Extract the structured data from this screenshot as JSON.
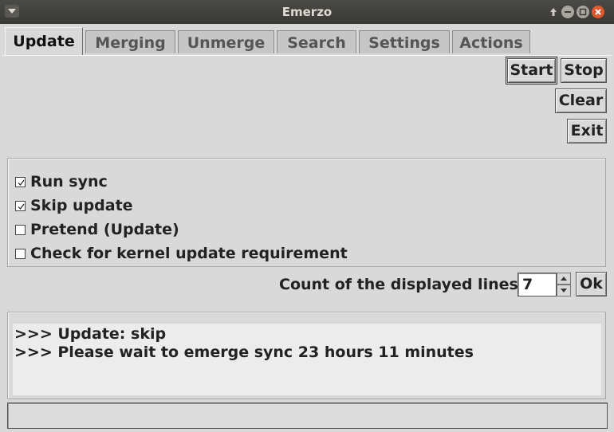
{
  "window": {
    "title": "Emerzo"
  },
  "tabs": [
    {
      "label": "Update",
      "active": true
    },
    {
      "label": "Merging",
      "active": false
    },
    {
      "label": "Unmerge",
      "active": false
    },
    {
      "label": "Search",
      "active": false
    },
    {
      "label": "Settings",
      "active": false
    },
    {
      "label": "Actions",
      "active": false
    }
  ],
  "buttons": {
    "start": "Start",
    "stop": "Stop",
    "clear": "Clear",
    "exit": "Exit",
    "ok": "Ok"
  },
  "options": [
    {
      "label": "Run sync",
      "checked": true
    },
    {
      "label": "Skip update",
      "checked": true
    },
    {
      "label": "Pretend (Update)",
      "checked": false
    },
    {
      "label": "Check for kernel update requirement",
      "checked": false
    }
  ],
  "lines_count": {
    "label": "Count of the displayed lines",
    "value": "7"
  },
  "output": {
    "lines": [
      ">>> Update: skip",
      ">>> Please wait to emerge sync 23 hours 11 minutes"
    ]
  },
  "status": {
    "text": ""
  },
  "colors": {
    "titlebar": "#3f3e3a",
    "close": "#e0582e",
    "background": "#d9d9d9"
  }
}
